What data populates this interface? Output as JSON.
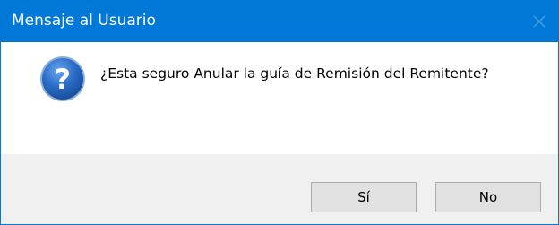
{
  "window": {
    "title": "Mensaje al Usuario",
    "title_bar_color": "#0078d7"
  },
  "dialog": {
    "icon": "question-icon",
    "message": "¿Esta seguro Anular la guía de Remisión del Remitente?"
  },
  "buttons": {
    "yes_label": "Sí",
    "no_label": "No"
  }
}
